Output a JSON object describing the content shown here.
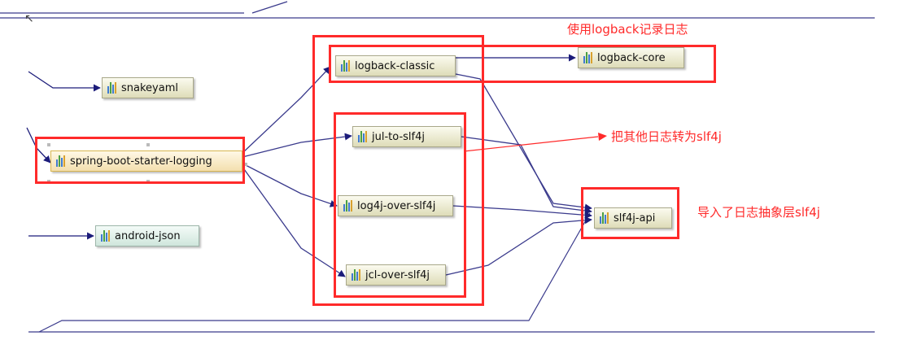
{
  "nodes": {
    "snakeyaml": "snakeyaml",
    "starter_logging": "spring-boot-starter-logging",
    "android_json": "android-json",
    "logback_classic": "logback-classic",
    "logback_core": "logback-core",
    "jul_to_slf4j": "jul-to-slf4j",
    "log4j_over_slf4j": "log4j-over-slf4j",
    "jcl_over_slf4j": "jcl-over-slf4j",
    "slf4j_api": "slf4j-api"
  },
  "annotations": {
    "logback": "使用logback记录日志",
    "convert": "把其他日志转为slf4j",
    "abstraction": "导入了日志抽象层slf4j"
  },
  "colors": {
    "edge": "#3a3a8c",
    "highlight": "#ff2a2a",
    "node_fill": "#e6e4c8",
    "node_selected_fill": "#f6e3b4"
  }
}
